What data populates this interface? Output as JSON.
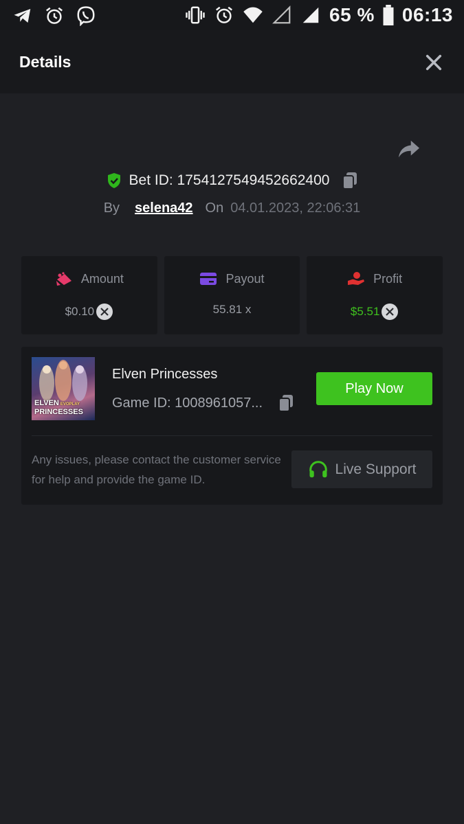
{
  "status_bar": {
    "battery": "65 %",
    "time": "06:13",
    "left_icons": [
      "telegram-icon",
      "alarm-icon",
      "viber-icon"
    ],
    "right_icons": [
      "vibrate-icon",
      "alarm-icon",
      "wifi-icon",
      "signal-empty-icon",
      "signal-icon",
      "battery-icon"
    ]
  },
  "header": {
    "title": "Details",
    "close_icon": "close-icon"
  },
  "bet": {
    "share_icon": "share-icon",
    "id_label": "Bet ID: 1754127549452662400",
    "by_label": "By",
    "username": "selena42",
    "on_label": "On",
    "datetime": "04.01.2023, 22:06:31"
  },
  "stats": {
    "amount": {
      "label": "Amount",
      "value": "$0.10",
      "icon": "amount-icon",
      "color": "#e53a6a"
    },
    "payout": {
      "label": "Payout",
      "value": "55.81 x",
      "icon": "card-icon",
      "color": "#7b4ae2"
    },
    "profit": {
      "label": "Profit",
      "value": "$5.51",
      "icon": "profit-hand-icon",
      "color": "#e03131",
      "value_color": "#3fc01e"
    }
  },
  "game": {
    "thumb_text": "ELVEN",
    "thumb_text_2": "PRINCESSES",
    "thumb_brand": "EVOPLAY",
    "name": "Elven Princesses",
    "id_label": "Game ID: 1008961057...",
    "play_label": "Play Now",
    "help_text": "Any issues, please contact the customer service for help and provide the game ID.",
    "support_label": "Live Support"
  },
  "colors": {
    "background": "#1f2024",
    "panel": "#17181b",
    "accent_green": "#3ec21f"
  }
}
